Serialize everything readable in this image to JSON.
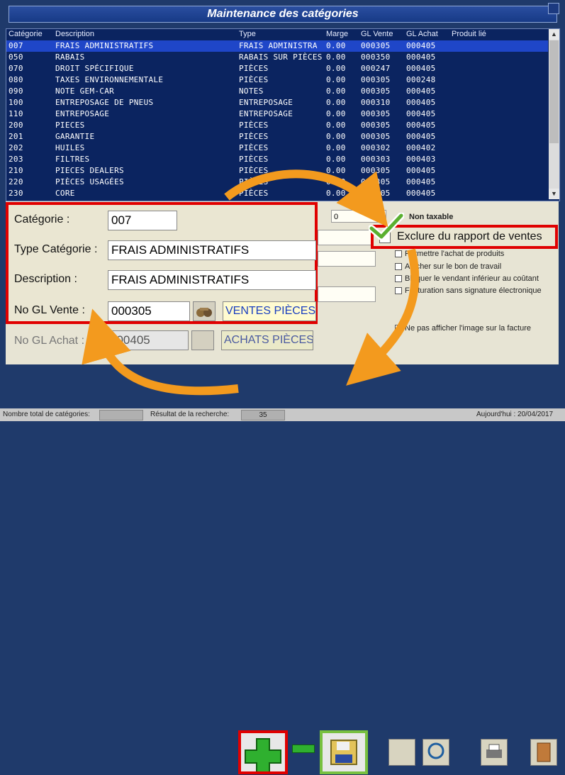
{
  "window": {
    "title": "Maintenance des catégories"
  },
  "grid": {
    "columns": [
      "Catégorie",
      "Description",
      "Type",
      "Marge",
      "GL Vente",
      "GL Achat",
      "Produit lié"
    ],
    "rows": [
      [
        "007",
        "FRAIS ADMINISTRATIFS",
        "FRAIS ADMINISTRA",
        "0.00",
        "000305",
        "000405",
        ""
      ],
      [
        "050",
        "RABAIS",
        "RABAIS SUR PIÈCES",
        "0.00",
        "000350",
        "000405",
        ""
      ],
      [
        "070",
        "DROIT SPÉCIFIQUE",
        "PIÈCES",
        "0.00",
        "000247",
        "000405",
        ""
      ],
      [
        "080",
        "TAXES ENVIRONNEMENTALE",
        "PIÈCES",
        "0.00",
        "000305",
        "000248",
        ""
      ],
      [
        "090",
        "NOTE GEM-CAR",
        "NOTES",
        "0.00",
        "000305",
        "000405",
        ""
      ],
      [
        "100",
        "ENTREPOSAGE DE PNEUS",
        "ENTREPOSAGE",
        "0.00",
        "000310",
        "000405",
        ""
      ],
      [
        "110",
        "ENTREPOSAGE",
        "ENTREPOSAGE",
        "0.00",
        "000305",
        "000405",
        ""
      ],
      [
        "200",
        "PIECES",
        "PIÈCES",
        "0.00",
        "000305",
        "000405",
        ""
      ],
      [
        "201",
        "GARANTIE",
        "PIÈCES",
        "0.00",
        "000305",
        "000405",
        ""
      ],
      [
        "202",
        "HUILES",
        "PIÈCES",
        "0.00",
        "000302",
        "000402",
        ""
      ],
      [
        "203",
        "FILTRES",
        "PIÈCES",
        "0.00",
        "000303",
        "000403",
        ""
      ],
      [
        "210",
        "PIECES DEALERS",
        "PIÈCES",
        "0.00",
        "000305",
        "000405",
        ""
      ],
      [
        "220",
        "PIÈCES USAGÉES",
        "PIÈCES",
        "0.00",
        "000305",
        "000405",
        ""
      ],
      [
        "230",
        "CORE",
        "PIÈCES",
        "0.00",
        "000305",
        "000405",
        ""
      ]
    ]
  },
  "form": {
    "categorie_label": "Catégorie :",
    "categorie_value": "007",
    "type_label": "Type Catégorie :",
    "type_value": "FRAIS ADMINISTRATIFS",
    "description_label": "Description :",
    "description_value": "FRAIS ADMINISTRATIFS",
    "gl_vente_label": "No GL Vente :",
    "gl_vente_value": "000305",
    "gl_vente_name": "VENTES PIÈCES",
    "gl_achat_label": "No GL Achat :",
    "gl_achat_value": "000405",
    "gl_achat_name": "ACHATS PIÈCES",
    "marge_value": "0"
  },
  "options": {
    "non_taxable": "Non taxable",
    "exclure": "Exclure du rapport de ventes",
    "permettre": "Permettre l'achat de produits",
    "afficher_bon": "Afficher sur le bon de travail",
    "bloquer": "Bloquer le vendant inférieur au coûtant",
    "facturation": "Facturation sans signature électronique",
    "ne_pas_afficher": "Ne pas afficher l'image sur la facture"
  },
  "status": {
    "total_label": "Nombre total de catégories:",
    "result_label": "Résultat de la recherche:",
    "result_value": "35",
    "today": "Aujourd'hui : 20/04/2017"
  },
  "icons": [
    "plus-icon",
    "minus-icon",
    "save-icon",
    "search-binoculars-icon",
    "zoom-icon",
    "printer-icon",
    "exit-icon"
  ],
  "colors": {
    "accent_highlight": "#e00000",
    "save_highlight": "#78c040",
    "arrow": "#f39a1e",
    "selected_row": "#1f46c8"
  }
}
